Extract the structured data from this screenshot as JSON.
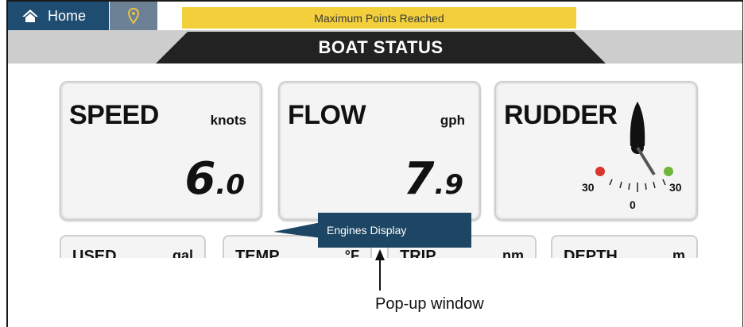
{
  "topbar": {
    "home_label": "Home",
    "alert_text": "Maximum Points Reached",
    "colors": {
      "nav": "#1f4d72",
      "pin": "#6d8196",
      "alert": "#f2cf3b"
    }
  },
  "title": "BOAT STATUS",
  "cards": {
    "speed": {
      "title": "SPEED",
      "unit": "knots",
      "int": "6",
      "dec": ".0"
    },
    "flow": {
      "title": "FLOW",
      "unit": "gph",
      "int": "7",
      "dec": ".9"
    },
    "rudder": {
      "title": "RUDDER",
      "left_label": "30",
      "right_label": "30",
      "center_label": "0"
    }
  },
  "small_cards": [
    {
      "title": "USED",
      "unit": "gal"
    },
    {
      "title": "TEMP",
      "unit": "°F"
    },
    {
      "title": "TRIP",
      "unit": "nm"
    },
    {
      "title": "DEPTH",
      "unit": "m"
    }
  ],
  "popup": {
    "label": "Engines Display"
  },
  "annotation": {
    "caption": "Pop-up window"
  }
}
